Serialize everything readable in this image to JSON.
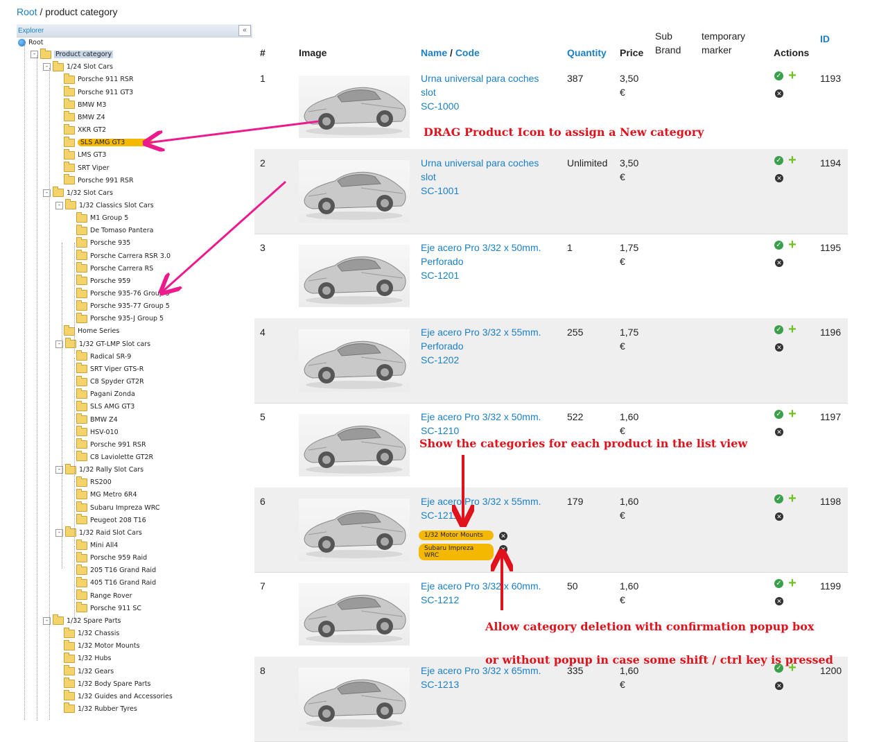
{
  "breadcrumb": {
    "root": "Root",
    "sep": " / ",
    "current": "product category"
  },
  "explorer": {
    "label": "Explorer",
    "collapse": "«"
  },
  "tree": [
    {
      "label": "Root",
      "level": 0,
      "icon": "globe"
    },
    {
      "label": "Product category",
      "level": 1,
      "exp": "-",
      "selected": "root"
    },
    {
      "label": "1/24 Slot Cars",
      "level": 2,
      "exp": "-"
    },
    {
      "label": "Porsche 911 RSR",
      "level": 3
    },
    {
      "label": "Porsche 911 GT3",
      "level": 3
    },
    {
      "label": "BMW M3",
      "level": 3
    },
    {
      "label": "BMW Z4",
      "level": 3
    },
    {
      "label": "XKR GT2",
      "level": 3
    },
    {
      "label": "SLS AMG GT3",
      "level": 3,
      "selected": "drop"
    },
    {
      "label": "LMS GT3",
      "level": 3
    },
    {
      "label": "SRT Viper",
      "level": 3
    },
    {
      "label": "Porsche 991 RSR",
      "level": 3
    },
    {
      "label": "1/32 Slot Cars",
      "level": 2,
      "exp": "-"
    },
    {
      "label": "1/32 Classics Slot Cars",
      "level": 3,
      "exp": "-"
    },
    {
      "label": "M1 Group 5",
      "level": 4
    },
    {
      "label": "De Tomaso Pantera",
      "level": 4
    },
    {
      "label": "Porsche 935",
      "level": 4
    },
    {
      "label": "Porsche Carrera RSR 3.0",
      "level": 4
    },
    {
      "label": "Porsche Carrera RS",
      "level": 4
    },
    {
      "label": "Porsche 959",
      "level": 4
    },
    {
      "label": "Porsche 935-76 Group 5",
      "level": 4
    },
    {
      "label": "Porsche 935-77 Group 5",
      "level": 4
    },
    {
      "label": "Porsche 935-J Group 5",
      "level": 4
    },
    {
      "label": "Home Series",
      "level": 3
    },
    {
      "label": "1/32 GT-LMP Slot cars",
      "level": 3,
      "exp": "-"
    },
    {
      "label": "Radical SR-9",
      "level": 4
    },
    {
      "label": "SRT Viper GTS-R",
      "level": 4
    },
    {
      "label": "C8 Spyder GT2R",
      "level": 4
    },
    {
      "label": "Pagani Zonda",
      "level": 4
    },
    {
      "label": "SLS AMG GT3",
      "level": 4
    },
    {
      "label": "BMW Z4",
      "level": 4
    },
    {
      "label": "HSV-010",
      "level": 4
    },
    {
      "label": "Porsche 991 RSR",
      "level": 4
    },
    {
      "label": "C8 Laviolette GT2R",
      "level": 4
    },
    {
      "label": "1/32 Rally Slot Cars",
      "level": 3,
      "exp": "-"
    },
    {
      "label": "RS200",
      "level": 4
    },
    {
      "label": "MG Metro 6R4",
      "level": 4
    },
    {
      "label": "Subaru Impreza WRC",
      "level": 4
    },
    {
      "label": "Peugeot 208 T16",
      "level": 4
    },
    {
      "label": "1/32 Raid Slot Cars",
      "level": 3,
      "exp": "-"
    },
    {
      "label": "Mini All4",
      "level": 4
    },
    {
      "label": "Porsche 959 Raid",
      "level": 4
    },
    {
      "label": "205 T16 Grand Raid",
      "level": 4
    },
    {
      "label": "405 T16 Grand Raid",
      "level": 4
    },
    {
      "label": "Range Rover",
      "level": 4
    },
    {
      "label": "Porsche 911 SC",
      "level": 4
    },
    {
      "label": "1/32 Spare Parts",
      "level": 2,
      "exp": "-"
    },
    {
      "label": "1/32 Chassis",
      "level": 3
    },
    {
      "label": "1/32 Motor Mounts",
      "level": 3
    },
    {
      "label": "1/32 Hubs",
      "level": 3
    },
    {
      "label": "1/32 Gears",
      "level": 3
    },
    {
      "label": "1/32 Body Spare Parts",
      "level": 3
    },
    {
      "label": "1/32 Guides and Accessories",
      "level": 3
    },
    {
      "label": "1/32 Rubber Tyres",
      "level": 3
    }
  ],
  "table": {
    "headers": {
      "num": "#",
      "image": "Image",
      "name": "Name",
      "slash": " / ",
      "code": "Code",
      "quantity": "Quantity",
      "price": "Price",
      "subbrand": "Sub Brand",
      "marker": "temporary marker",
      "actions": "Actions",
      "id": "ID"
    },
    "rows": [
      {
        "num": "1",
        "name": "Urna universal para coches slot",
        "code": "SC-1000",
        "qty": "387",
        "price": "3,50 €",
        "id": "1193",
        "cats": []
      },
      {
        "num": "2",
        "name": "Urna universal para coches slot",
        "code": "SC-1001",
        "qty": "Unlimited",
        "price": "3,50 €",
        "id": "1194",
        "cats": []
      },
      {
        "num": "3",
        "name": "Eje acero Pro 3/32 x 50mm. Perforado",
        "code": "SC-1201",
        "qty": "1",
        "price": "1,75 €",
        "id": "1195",
        "cats": []
      },
      {
        "num": "4",
        "name": "Eje acero Pro 3/32 x 55mm. Perforado",
        "code": "SC-1202",
        "qty": "255",
        "price": "1,75 €",
        "id": "1196",
        "cats": []
      },
      {
        "num": "5",
        "name": "Eje acero Pro 3/32 x 50mm.",
        "code": "SC-1210",
        "qty": "522",
        "price": "1,60 €",
        "id": "1197",
        "cats": []
      },
      {
        "num": "6",
        "name": "Eje acero Pro 3/32 x 55mm.",
        "code": "SC-1211",
        "qty": "179",
        "price": "1,60 €",
        "id": "1198",
        "cats": [
          "1/32 Motor Mounts",
          "Subaru Impreza WRC"
        ]
      },
      {
        "num": "7",
        "name": "Eje acero Pro 3/32 x 60mm.",
        "code": "SC-1212",
        "qty": "50",
        "price": "1,60 €",
        "id": "1199",
        "cats": []
      },
      {
        "num": "8",
        "name": "Eje acero Pro 3/32 x 65mm.",
        "code": "SC-1213",
        "qty": "335",
        "price": "1,60 €",
        "id": "1200",
        "cats": []
      }
    ]
  },
  "annotations": {
    "drag": "DRAG Product Icon to assign a New category",
    "show": "Show the categories for each product in the list view",
    "delete1": "Allow category deletion with confirmation popup box",
    "delete2": "or without popup in case some shift / ctrl key is pressed"
  },
  "colors": {
    "link": "#1a7fc4",
    "selected": "#f5b800",
    "annotation": "#e0121c",
    "arrow_pink": "#ec1a8c"
  }
}
